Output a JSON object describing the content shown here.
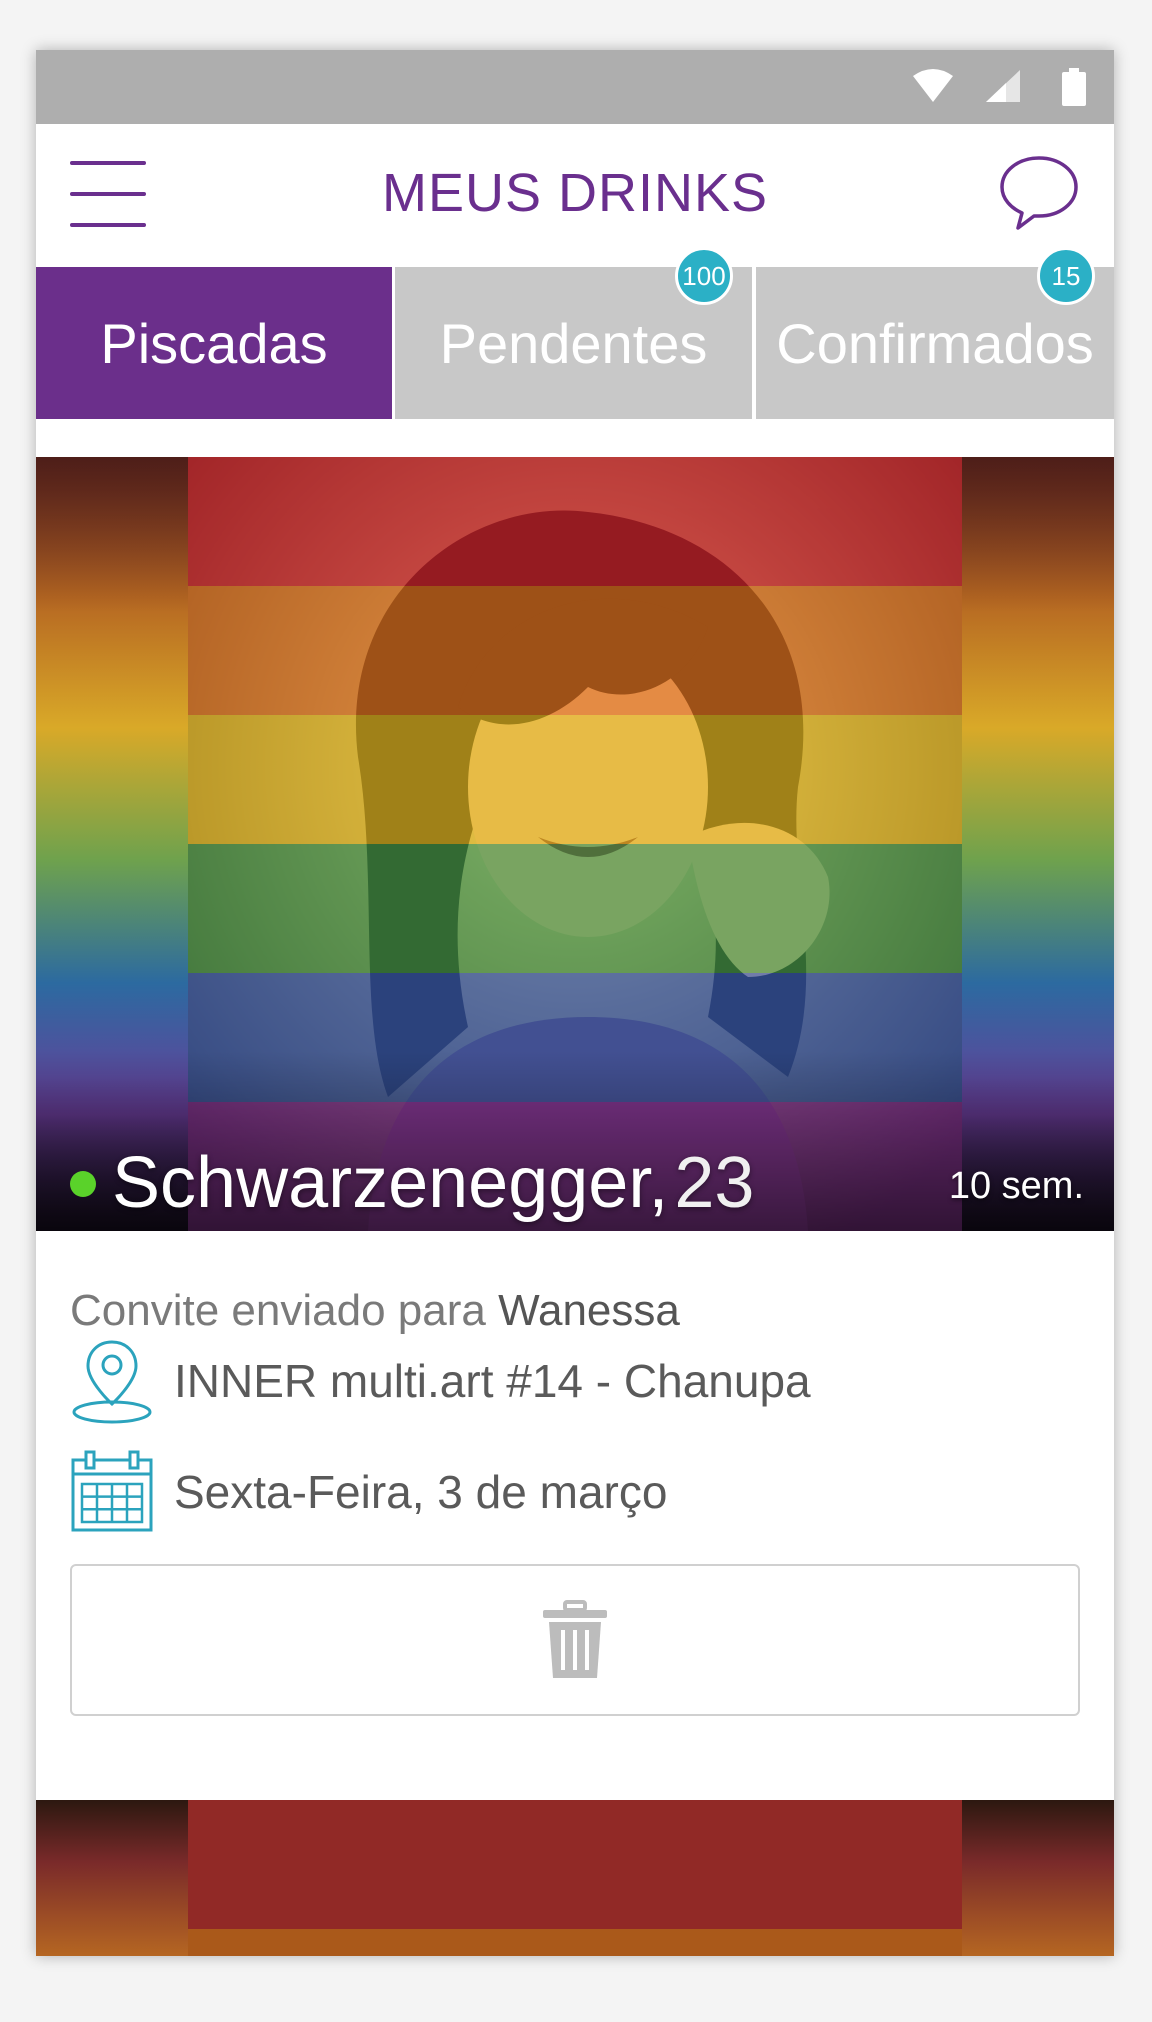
{
  "header": {
    "title": "MEUS DRINKS"
  },
  "tabs": [
    {
      "label": "Piscadas",
      "active": true
    },
    {
      "label": "Pendentes",
      "badge": "100"
    },
    {
      "label": "Confirmados",
      "badge": "15"
    }
  ],
  "card": {
    "name": "Schwarzenegger,",
    "age": "23",
    "time_ago": "10 sem.",
    "online": true,
    "invite_prefix": "Convite enviado para",
    "invite_name": "Wanessa",
    "location": "INNER multi.art #14 - Chanupa",
    "date": "Sexta-Feira, 3 de março"
  },
  "colors": {
    "brand_purple": "#6b2f8b",
    "tab_inactive": "#c8c8c8",
    "badge_teal": "#2bb0c6",
    "online_green": "#5ad22a",
    "icon_teal": "#2ba3bd"
  },
  "icons": {
    "menu": "hamburger-icon",
    "chat": "speech-bubble-icon",
    "location": "map-pin-icon",
    "calendar": "calendar-icon",
    "delete": "trash-icon"
  }
}
